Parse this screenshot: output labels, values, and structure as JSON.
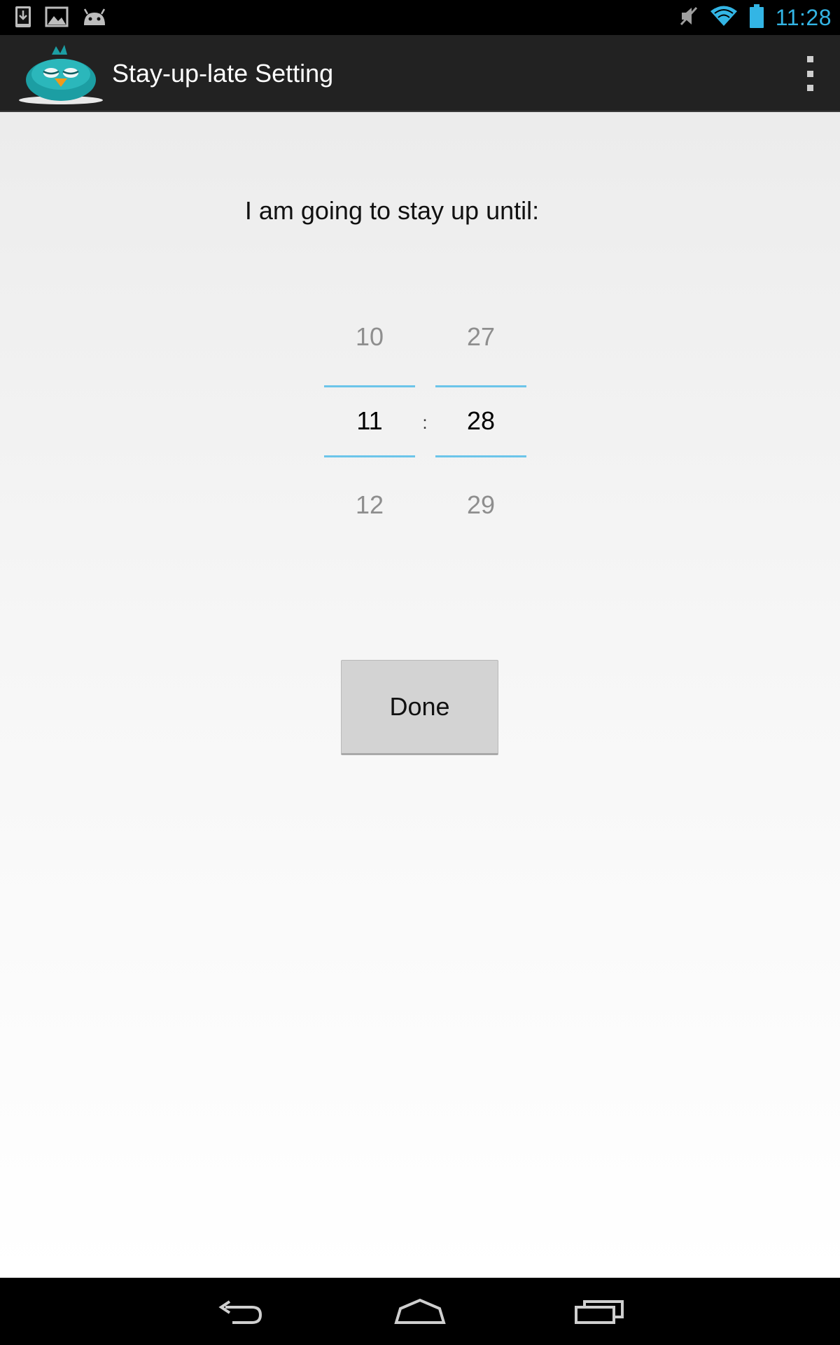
{
  "status_bar": {
    "time": "11:28",
    "notification_icons": [
      "download-icon",
      "image-icon",
      "android-icon"
    ],
    "system_icons": [
      "mute-icon",
      "wifi-icon",
      "battery-icon"
    ],
    "accent_color": "#33b5e5"
  },
  "action_bar": {
    "title": "Stay-up-late Setting",
    "logo_icon": "sleepy-bird-icon",
    "overflow_icon": "overflow-menu-icon"
  },
  "main": {
    "prompt": "I am going to stay up until:",
    "separator": ":",
    "hour_picker": {
      "prev": "10",
      "current": "11",
      "next": "12"
    },
    "minute_picker": {
      "prev": "27",
      "current": "28",
      "next": "29"
    },
    "done_label": "Done"
  },
  "nav_bar": {
    "buttons": [
      "back-icon",
      "home-icon",
      "recent-apps-icon"
    ]
  }
}
